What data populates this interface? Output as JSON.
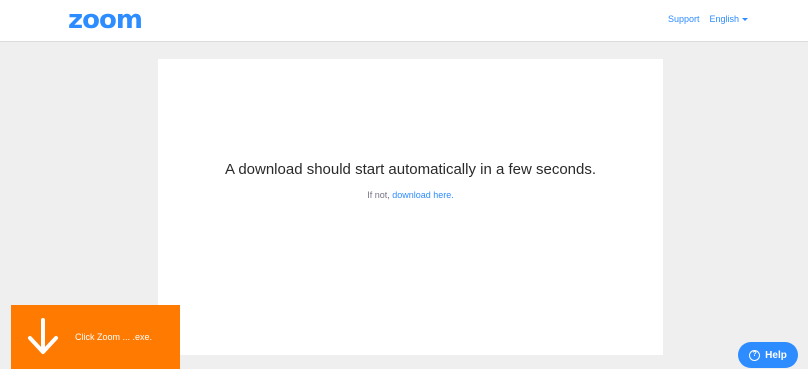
{
  "header": {
    "logo_text": "zoom",
    "support_label": "Support",
    "language_label": "English"
  },
  "main": {
    "message": "A download should start automatically in a few seconds.",
    "fallback_prefix": "If not,",
    "fallback_link": "download here."
  },
  "banner": {
    "text": "Click Zoom ... .exe."
  },
  "help": {
    "label": "Help",
    "icon_glyph": "?"
  },
  "colors": {
    "brand_blue": "#2d8cff",
    "banner_orange": "#ff7a00",
    "page_background": "#efefef"
  },
  "icons": {
    "logo": "zoom-logo",
    "language_caret": "chevron-down-icon",
    "banner_arrow": "arrow-down-icon",
    "help": "question-circle-icon"
  }
}
